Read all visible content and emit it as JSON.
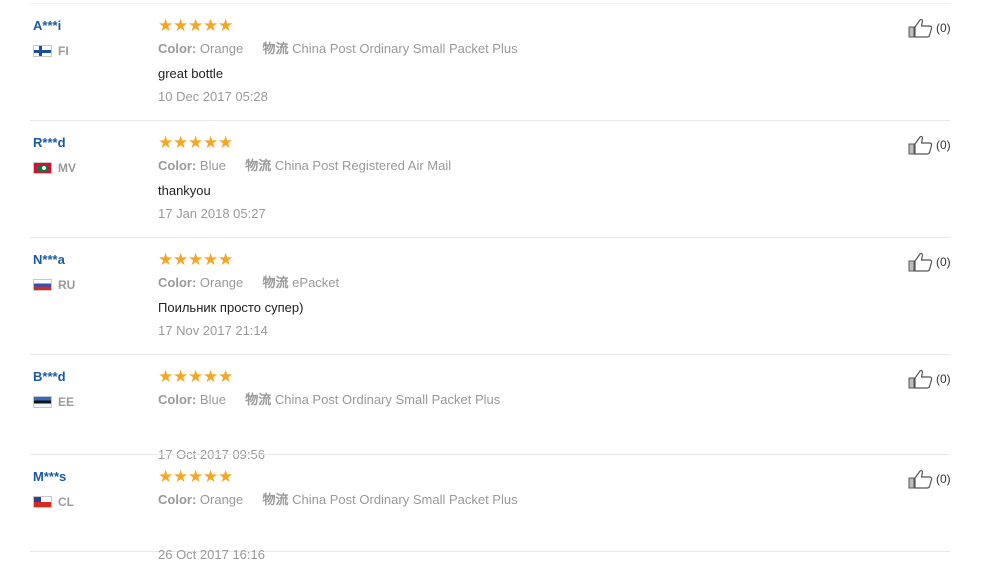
{
  "reviews": [
    {
      "user": "A***i",
      "country": "FI",
      "flag_icon": "finland-flag-icon",
      "stars": "★★★★★",
      "color_label": "Color:",
      "color_value": "Orange",
      "shipping_label": "物流",
      "shipping_value": "China Post Ordinary Small Packet Plus",
      "comment": "great bottle",
      "date": "10 Dec 2017 05:28",
      "helpful_count": "(0)"
    },
    {
      "user": "R***d",
      "country": "MV",
      "flag_icon": "maldives-flag-icon",
      "stars": "★★★★★",
      "color_label": "Color:",
      "color_value": "Blue",
      "shipping_label": "物流",
      "shipping_value": "China Post Registered Air Mail",
      "comment": "thankyou",
      "date": "17 Jan 2018 05:27",
      "helpful_count": "(0)"
    },
    {
      "user": "N***a",
      "country": "RU",
      "flag_icon": "russia-flag-icon",
      "stars": "★★★★★",
      "color_label": "Color:",
      "color_value": "Orange",
      "shipping_label": "物流",
      "shipping_value": "ePacket",
      "comment": "Поильник просто супер)",
      "date": "17 Nov 2017 21:14",
      "helpful_count": "(0)"
    },
    {
      "user": "B***d",
      "country": "EE",
      "flag_icon": "estonia-flag-icon",
      "stars": "★★★★★",
      "color_label": "Color:",
      "color_value": "Blue",
      "shipping_label": "物流",
      "shipping_value": "China Post Ordinary Small Packet Plus",
      "comment": "",
      "date": "17 Oct 2017 09:56",
      "helpful_count": "(0)"
    },
    {
      "user": "M***s",
      "country": "CL",
      "flag_icon": "chile-flag-icon",
      "stars": "★★★★★",
      "color_label": "Color:",
      "color_value": "Orange",
      "shipping_label": "物流",
      "shipping_value": "China Post Ordinary Small Packet Plus",
      "comment": "",
      "date": "26 Oct 2017 16:16",
      "helpful_count": "(0)"
    }
  ],
  "colors": {
    "username": "#1a5aa0",
    "star": "#f5a623",
    "muted_text": "#999999",
    "divider": "#e8e8e8"
  },
  "icons": {
    "helpful": "thumbs-up-icon",
    "rating": "star-icon"
  }
}
